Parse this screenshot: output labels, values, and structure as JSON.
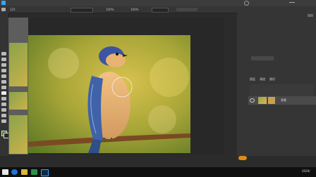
{
  "menubar": {
    "items": [
      "Ps"
    ]
  },
  "options_bar": {
    "brush_size": "125",
    "opacity": "100%",
    "flow": "100%"
  },
  "doc_tab": {
    "title": ""
  },
  "right_panel": {
    "tabs": [
      "图层",
      "通道",
      "路径"
    ],
    "layer": {
      "name": "背景"
    }
  },
  "taskbar": {
    "time": "2020/"
  },
  "colors": {
    "accent_orange": "#e08a18",
    "panel_bg": "#353535",
    "app_bg": "#2b2b2b"
  }
}
